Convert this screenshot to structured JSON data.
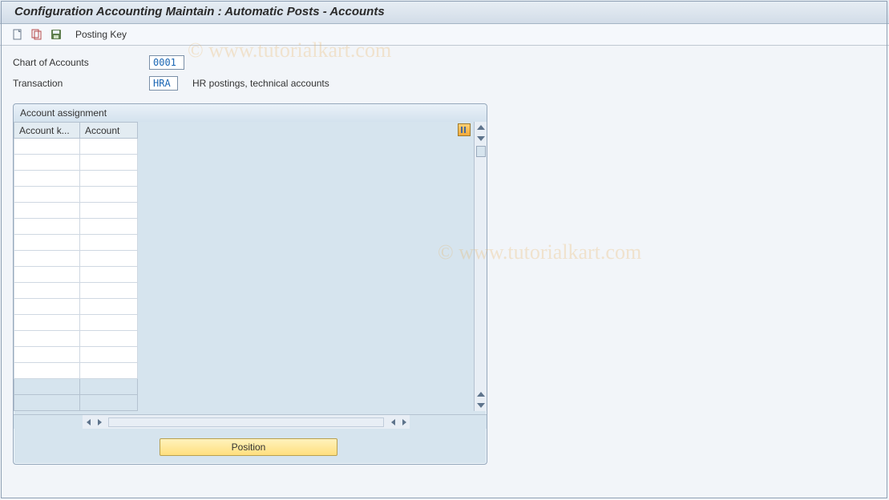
{
  "header": {
    "title": "Configuration Accounting Maintain : Automatic Posts - Accounts"
  },
  "toolbar": {
    "posting_key_label": "Posting Key"
  },
  "fields": {
    "chart_label": "Chart of Accounts",
    "chart_value": "0001",
    "transaction_label": "Transaction",
    "transaction_value": "HRA",
    "transaction_desc": "HR postings, technical accounts"
  },
  "panel": {
    "title": "Account assignment",
    "columns": {
      "key": "Account k...",
      "account": "Account"
    }
  },
  "buttons": {
    "position": "Position"
  },
  "watermark": "© www.tutorialkart.com"
}
